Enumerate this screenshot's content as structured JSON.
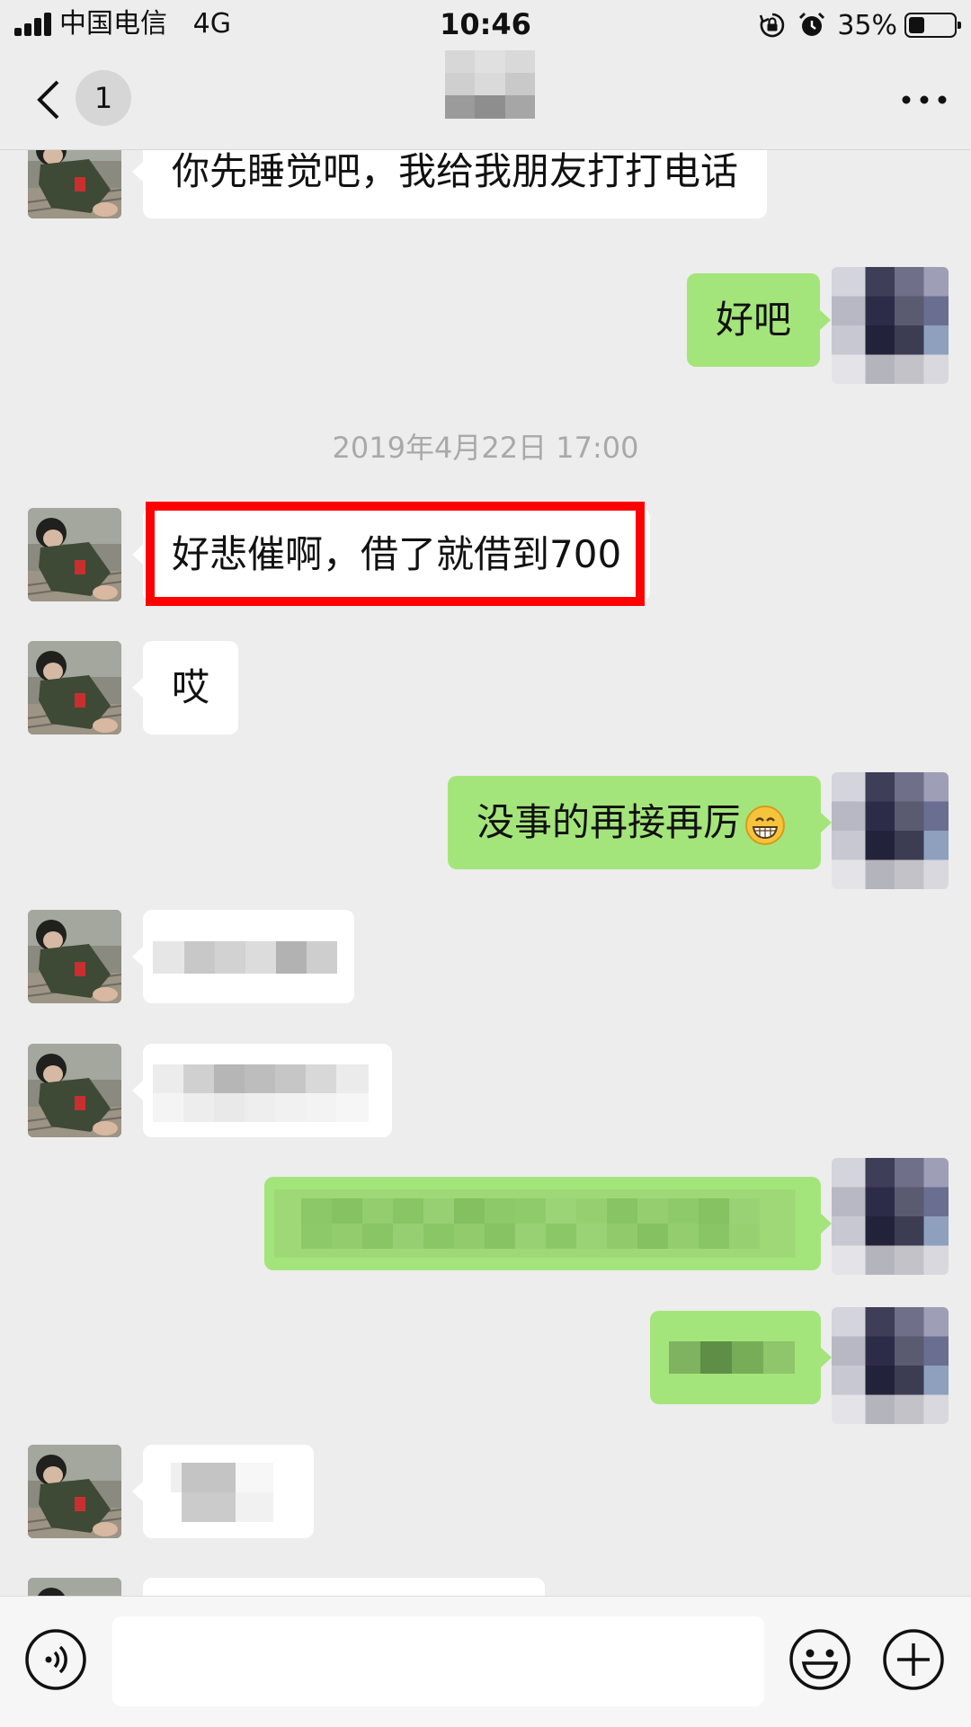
{
  "status_bar": {
    "carrier": "中国电信",
    "network": "4G",
    "time": "10:46",
    "battery_percent": "35%",
    "battery_level": 0.35,
    "icons": [
      "signal-icon",
      "orientation-lock-icon",
      "alarm-icon",
      "battery-icon"
    ]
  },
  "nav": {
    "back_icon": "chevron-left-icon",
    "unread_count": "1",
    "more_icon": "more-dots-icon"
  },
  "chat": {
    "timestamp": "2019年4月22日 17:00",
    "messages": [
      {
        "side": "left",
        "text": "你先睡觉吧，我给我朋友打打电话"
      },
      {
        "side": "right",
        "text": "好吧"
      },
      {
        "side": "left",
        "text": "好悲催啊，借了就借到700",
        "highlighted": true
      },
      {
        "side": "left",
        "text": "哎"
      },
      {
        "side": "right",
        "text": "没事的再接再厉",
        "emoji": "grinning-face-icon"
      },
      {
        "side": "left",
        "text": "",
        "blurred": true
      },
      {
        "side": "left",
        "text": "",
        "blurred": true
      },
      {
        "side": "right",
        "text": "",
        "blurred": true
      },
      {
        "side": "right",
        "text": "",
        "blurred": true
      },
      {
        "side": "left",
        "text": "",
        "blurred": true
      },
      {
        "side": "left",
        "text": "",
        "blurred": true
      }
    ]
  },
  "input_bar": {
    "voice_icon": "voice-icon",
    "input_value": "",
    "emoji_icon": "emoji-icon",
    "plus_icon": "plus-circle-icon"
  },
  "colors": {
    "background": "#ededed",
    "bubble_self": "#a4e57b",
    "bubble_other": "#ffffff",
    "highlight": "#ff0000",
    "timestamp_text": "#a9a9a9"
  }
}
